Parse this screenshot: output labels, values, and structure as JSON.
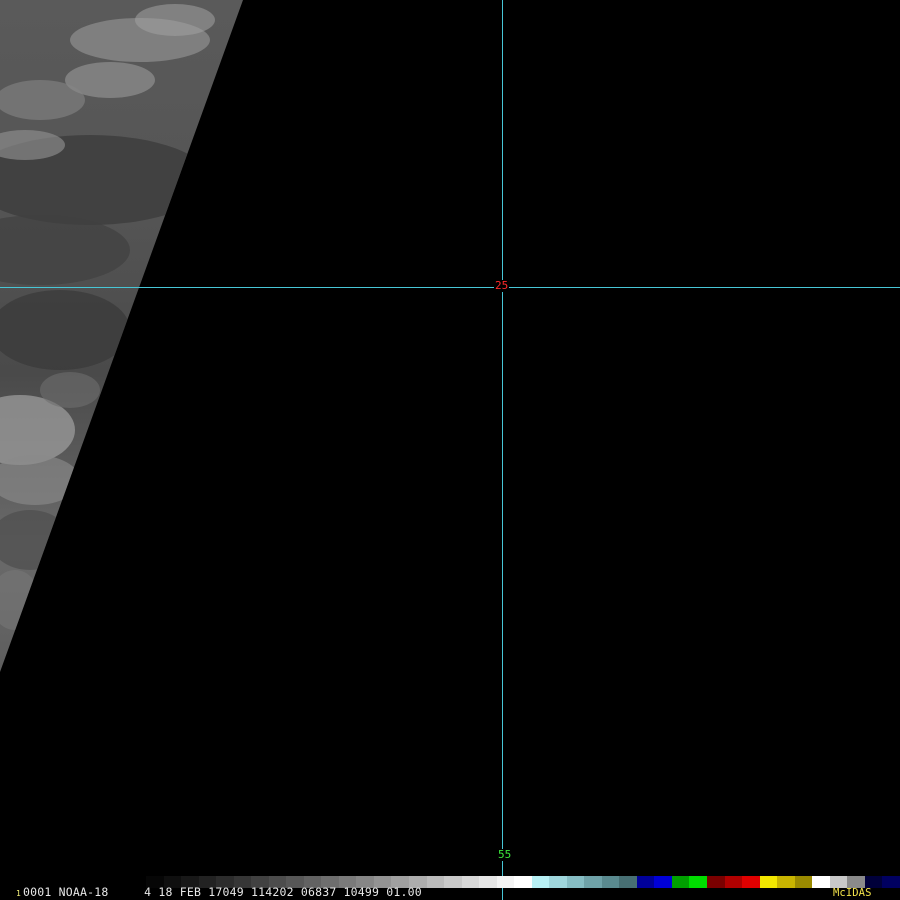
{
  "image": {
    "satellite": "NOAA-18",
    "frame_number": "0001",
    "frame_marker": "1",
    "status_line": "0001 NOAA-18     4 18 FEB 17049 114202 06837 10499 01.00",
    "software_label": "McIDAS"
  },
  "grid": {
    "latitude_label": "25",
    "longitude_label": "55",
    "line_color": "#47c6d6",
    "latitude_label_color": "#ff2a2a",
    "longitude_label_color": "#3ce63c"
  },
  "colorbar": {
    "segments": [
      "#060606",
      "#0f0f0f",
      "#181818",
      "#222222",
      "#2c2c2c",
      "#363636",
      "#414141",
      "#4c4c4c",
      "#575757",
      "#626262",
      "#6e6e6e",
      "#7a7a7a",
      "#868686",
      "#939393",
      "#a0a0a0",
      "#adadad",
      "#bbbbbb",
      "#c9c9c9",
      "#d8d8d8",
      "#e6e6e6",
      "#f4f4f4",
      "#ffffff",
      "#b7f0f4",
      "#9fd6dc",
      "#86bdc3",
      "#6fa2a8",
      "#5a8a8f",
      "#476f73",
      "#00009a",
      "#0000d8",
      "#00a000",
      "#00dc00",
      "#7a0000",
      "#b00000",
      "#e00000",
      "#f2e600",
      "#c8b400",
      "#9a8a00",
      "#ffffff",
      "#c8c8c8",
      "#8a8a8a",
      "#00003a",
      "#000060"
    ]
  }
}
